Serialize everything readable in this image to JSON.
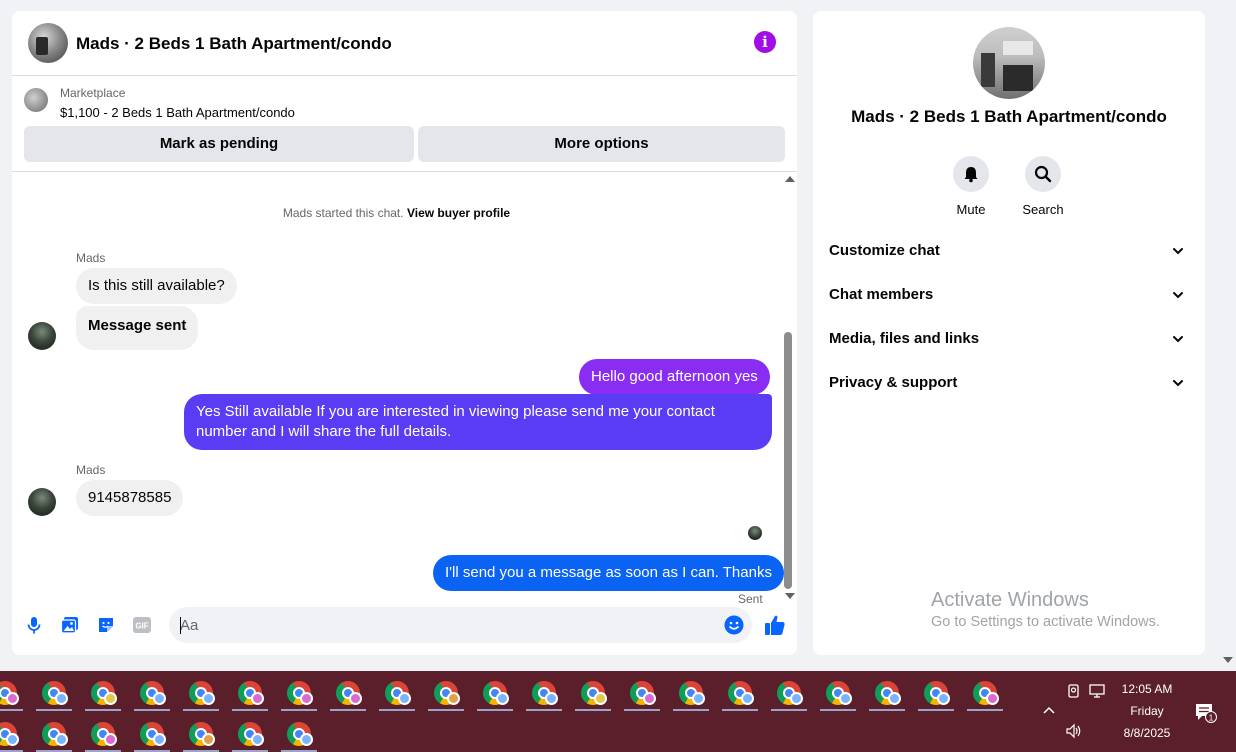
{
  "chat": {
    "title": "Mads · 2 Beds 1 Bath Apartment/condo",
    "marketplace": {
      "label": "Marketplace",
      "listing": "$1,100 - 2 Beds 1 Bath Apartment/condo"
    },
    "buttons": {
      "mark_pending": "Mark as pending",
      "more_options": "More options"
    },
    "system_note": {
      "text": "Mads started this chat.",
      "link": "View buyer profile"
    },
    "messages": [
      {
        "sender": "Mads",
        "direction": "in",
        "text": "Is this still available?"
      },
      {
        "direction": "in",
        "text": "Message sent"
      },
      {
        "direction": "out",
        "text": "Hello good afternoon yes"
      },
      {
        "direction": "out",
        "text": "Yes Still available If you are interested in viewing please send me your contact",
        "text2": "number and I will share the full details."
      },
      {
        "sender": "Mads",
        "direction": "in",
        "text": "9145878585"
      },
      {
        "direction": "out",
        "text": "I'll send you a message as soon as I can. Thanks"
      }
    ],
    "sent_status": "Sent",
    "composer": {
      "placeholder": "Aa"
    },
    "colors": {
      "out_bubble_top": "#a128f2",
      "out_bubble_mid": "#5b3df5",
      "out_bubble_bottom": "#0a66f2",
      "accent": "#0866ff",
      "info": "#a10ee8"
    }
  },
  "info_panel": {
    "title": "Mads · 2 Beds 1 Bath Apartment/condo",
    "actions": [
      {
        "label": "Mute",
        "icon": "bell-icon"
      },
      {
        "label": "Search",
        "icon": "search-icon"
      }
    ],
    "sections": [
      {
        "label": "Customize chat"
      },
      {
        "label": "Chat members"
      },
      {
        "label": "Media, files and links"
      },
      {
        "label": "Privacy & support"
      }
    ]
  },
  "watermark": {
    "line1": "Activate Windows",
    "line2": "Go to Settings to activate Windows."
  },
  "taskbar": {
    "time": "12:05 AM",
    "day": "Friday",
    "date": "8/8/2025",
    "notification_count": "1",
    "badge_colors": [
      "#d96bd0",
      "#7ab4ff",
      "#e3c94a",
      "#7ab4ff",
      "#7ab4ff",
      "#d96bd0",
      "#d96bd0",
      "#d96bd0",
      "#7ab4ff",
      "#e3a04a",
      "#7ab4ff",
      "#7ab4ff",
      "#e3c94a",
      "#d96bd0",
      "#7ab4ff",
      "#7ab4ff",
      "#7ab4ff",
      "#7ab4ff",
      "#7ab4ff",
      "#7ab4ff",
      "#d96bd0",
      "#7ab4ff",
      "#7ab4ff",
      "#d96bd0",
      "#7ab4ff",
      "#e3a04a",
      "#7ab4ff",
      "#7ab4ff"
    ]
  }
}
